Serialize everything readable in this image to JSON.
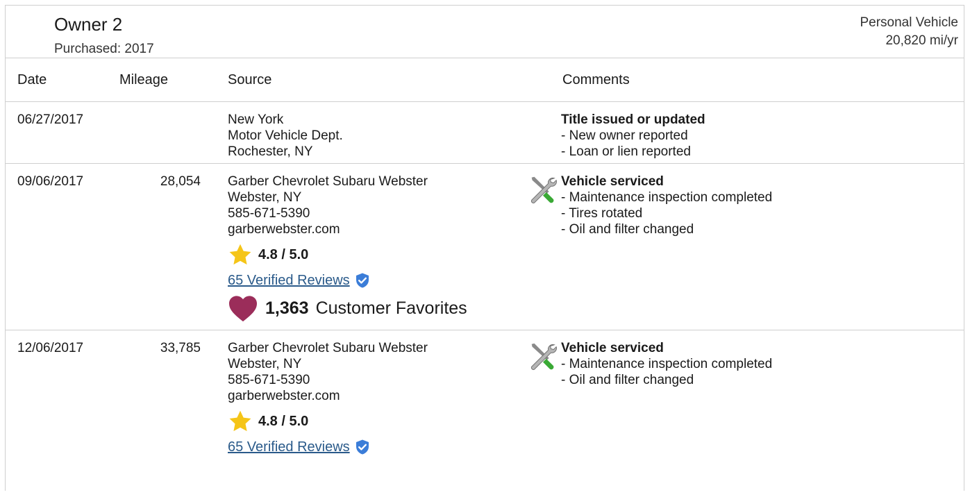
{
  "owner": {
    "title": "Owner 2",
    "purchased": "Purchased: 2017",
    "usage": "Personal Vehicle",
    "rate": "20,820 mi/yr"
  },
  "columns": {
    "date": "Date",
    "mileage": "Mileage",
    "source": "Source",
    "comments": "Comments"
  },
  "rows": [
    {
      "date": "06/27/2017",
      "mileage": "",
      "source": [
        "New York",
        "Motor Vehicle Dept.",
        "Rochester, NY"
      ],
      "comment_title": "Title issued or updated",
      "comments": [
        "- New owner reported",
        "- Loan or lien reported"
      ]
    },
    {
      "date": "09/06/2017",
      "mileage": "28,054",
      "source": [
        "Garber Chevrolet Subaru Webster",
        "Webster, NY",
        "585-671-5390",
        "garberwebster.com"
      ],
      "rating": "4.8 / 5.0",
      "reviews": "65 Verified Reviews",
      "favorites_count": "1,363",
      "favorites_label": "Customer Favorites",
      "comment_title": "Vehicle serviced",
      "comments": [
        "- Maintenance inspection completed",
        "- Tires rotated",
        "- Oil and filter changed"
      ]
    },
    {
      "date": "12/06/2017",
      "mileage": "33,785",
      "source": [
        "Garber Chevrolet Subaru Webster",
        "Webster, NY",
        "585-671-5390",
        "garberwebster.com"
      ],
      "rating": "4.8 / 5.0",
      "reviews": "65 Verified Reviews",
      "comment_title": "Vehicle serviced",
      "comments": [
        "- Maintenance inspection completed",
        "- Oil and filter changed"
      ]
    }
  ],
  "colors": {
    "link": "#2a5a8a",
    "star": "#f5c518",
    "heart": "#9b2d5a",
    "shield": "#3b7dd8"
  },
  "icons": {
    "rating": "star-icon",
    "verified": "shield-check-icon",
    "favorite": "heart-icon",
    "service": "wrench-screwdriver-icon"
  }
}
